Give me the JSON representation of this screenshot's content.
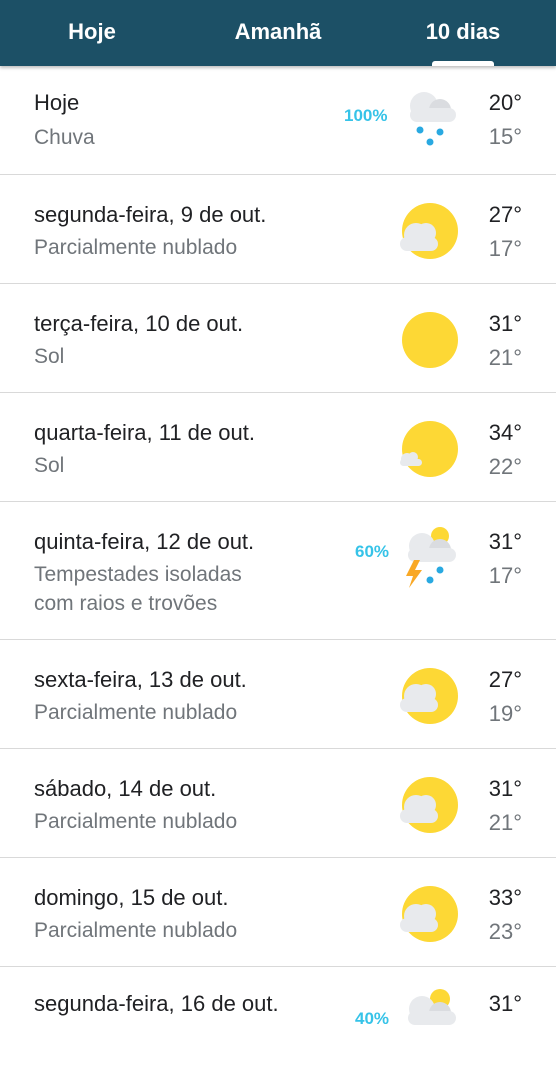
{
  "tabs": [
    {
      "label": "Hoje",
      "active": false
    },
    {
      "label": "Amanhã",
      "active": false
    },
    {
      "label": "10 dias",
      "active": true
    }
  ],
  "days": [
    {
      "day": "Hoje",
      "condition": "Chuva",
      "high": "20°",
      "low": "15°",
      "precip": "100%",
      "icon": "rain-icon"
    },
    {
      "day": "segunda-feira, 9 de out.",
      "condition": "Parcialmente nublado",
      "high": "27°",
      "low": "17°",
      "precip": "",
      "icon": "partly-cloudy-icon"
    },
    {
      "day": "terça-feira, 10 de out.",
      "condition": "Sol",
      "high": "31°",
      "low": "21°",
      "precip": "",
      "icon": "sun-icon"
    },
    {
      "day": "quarta-feira, 11 de out.",
      "condition": "Sol",
      "high": "34°",
      "low": "22°",
      "precip": "",
      "icon": "mostly-sunny-icon"
    },
    {
      "day": "quinta-feira, 12 de out.",
      "condition_line1": "Tempestades isoladas",
      "condition_line2": "com raios e trovões",
      "high": "31°",
      "low": "17°",
      "precip": "60%",
      "icon": "thunderstorm-icon"
    },
    {
      "day": "sexta-feira, 13 de out.",
      "condition": "Parcialmente nublado",
      "high": "27°",
      "low": "19°",
      "precip": "",
      "icon": "partly-cloudy-icon"
    },
    {
      "day": "sábado, 14 de out.",
      "condition": "Parcialmente nublado",
      "high": "31°",
      "low": "21°",
      "precip": "",
      "icon": "partly-cloudy-icon"
    },
    {
      "day": "domingo, 15 de out.",
      "condition": "Parcialmente nublado",
      "high": "33°",
      "low": "23°",
      "precip": "",
      "icon": "partly-cloudy-icon"
    },
    {
      "day": "segunda-feira, 16 de out.",
      "high": "31°",
      "precip": "40%",
      "icon": "scattered-showers-icon"
    }
  ],
  "colors": {
    "header": "#1c5066",
    "precip": "#36c3e8",
    "sun": "#fdd835",
    "cloud": "#e8eaed",
    "rain": "#29a9e1",
    "bolt": "#f9a825"
  }
}
